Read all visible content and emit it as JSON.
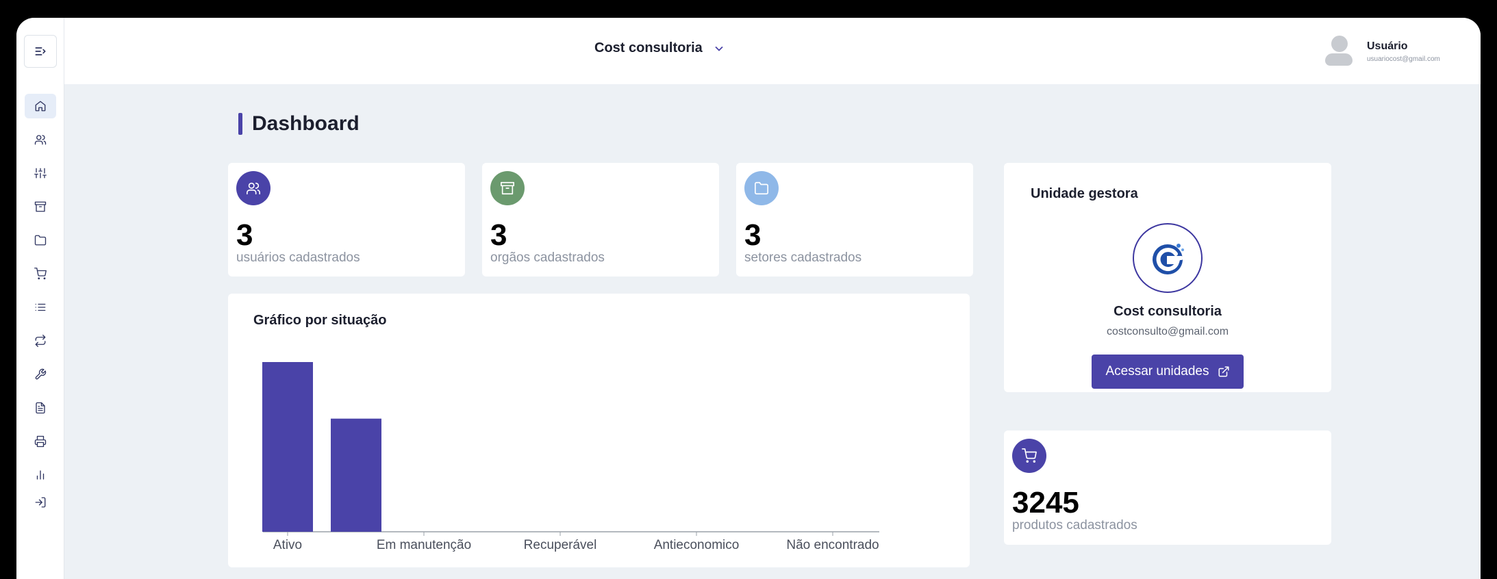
{
  "header": {
    "org_name": "Cost consultoria",
    "user_name": "Usuário",
    "user_email": "usuariocost@gmail.com"
  },
  "sidebar": {
    "items": [
      {
        "id": "home",
        "icon": "home-icon",
        "active": true
      },
      {
        "id": "users",
        "icon": "users-icon"
      },
      {
        "id": "settings",
        "icon": "sliders-icon"
      },
      {
        "id": "archive",
        "icon": "archive-icon"
      },
      {
        "id": "folder",
        "icon": "folder-icon"
      },
      {
        "id": "cart",
        "icon": "cart-icon"
      },
      {
        "id": "list",
        "icon": "list-icon"
      },
      {
        "id": "transfer",
        "icon": "repeat-icon"
      },
      {
        "id": "tools",
        "icon": "wrench-icon"
      },
      {
        "id": "document",
        "icon": "file-icon"
      },
      {
        "id": "print",
        "icon": "printer-icon"
      },
      {
        "id": "reports",
        "icon": "bar-chart-icon"
      },
      {
        "id": "logout",
        "icon": "log-in-icon"
      }
    ]
  },
  "page": {
    "title": "Dashboard"
  },
  "stats": [
    {
      "value": "3",
      "label": "usuários cadastrados",
      "icon": "users-icon",
      "color": "#4a43a8"
    },
    {
      "value": "3",
      "label": "orgãos cadastrados",
      "icon": "archive-icon",
      "color": "#6b9a6e"
    },
    {
      "value": "3",
      "label": "setores cadastrados",
      "icon": "folder-icon",
      "color": "#8fb8e8"
    }
  ],
  "chart": {
    "title": "Gráfico por situação",
    "chart_data": {
      "type": "bar",
      "categories": [
        "Ativo",
        "Em manutenção",
        "Recuperável",
        "Antieconomico",
        "Não encontrado"
      ],
      "series": [
        {
          "values": [
            3,
            2,
            0,
            0,
            0
          ]
        }
      ],
      "bar_color": "#4a43a8",
      "ylim": [
        0,
        3
      ]
    }
  },
  "unit": {
    "title": "Unidade gestora",
    "name": "Cost consultoria",
    "email": "costconsulto@gmail.com",
    "button_label": "Acessar unidades"
  },
  "products": {
    "value": "3245",
    "label": "produtos cadastrados",
    "icon": "cart-icon",
    "color": "#4a43a8"
  }
}
